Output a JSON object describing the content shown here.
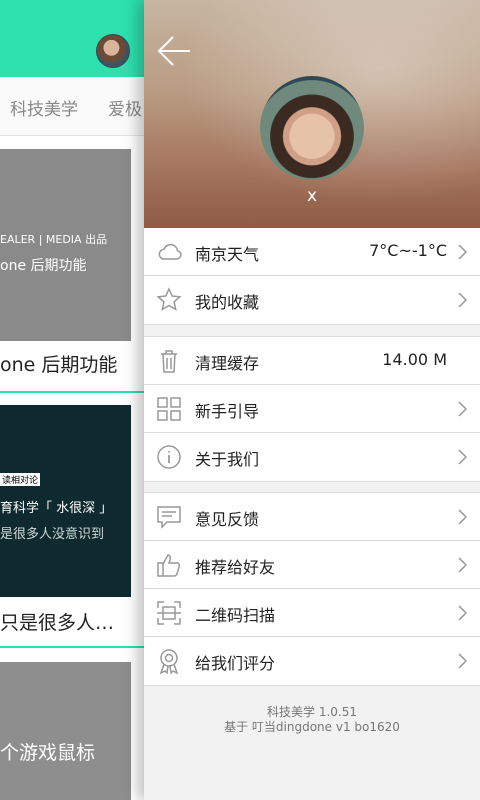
{
  "main": {
    "tabs": [
      "科技美学",
      "爱极"
    ],
    "cards": [
      {
        "thumb_lines": [
          "EALER | MEDIA 出品",
          "one 后期功能"
        ],
        "title": "one 后期功能"
      },
      {
        "thumb_lines": [
          "读相对论",
          "育科学「 水很深 」",
          "是很多人没意识到"
        ],
        "title": "只是很多人…"
      },
      {
        "thumb_lines": [
          "个游戏鼠标"
        ],
        "title": ""
      }
    ]
  },
  "drawer": {
    "username": "x",
    "groups": [
      [
        {
          "icon": "cloud-icon",
          "label": "南京天气",
          "value": "7°C~-1°C",
          "arrow": true
        },
        {
          "icon": "star-icon",
          "label": "我的收藏",
          "value": "",
          "arrow": true
        }
      ],
      [
        {
          "icon": "trash-icon",
          "label": "清理缓存",
          "value": "14.00 M",
          "arrow": false
        },
        {
          "icon": "grid-icon",
          "label": "新手引导",
          "value": "",
          "arrow": true
        },
        {
          "icon": "info-icon",
          "label": "关于我们",
          "value": "",
          "arrow": true
        }
      ],
      [
        {
          "icon": "feedback-icon",
          "label": "意见反馈",
          "value": "",
          "arrow": true
        },
        {
          "icon": "thumbs-up-icon",
          "label": "推荐给好友",
          "value": "",
          "arrow": true
        },
        {
          "icon": "qr-scan-icon",
          "label": "二维码扫描",
          "value": "",
          "arrow": true
        },
        {
          "icon": "award-icon",
          "label": "给我们评分",
          "value": "",
          "arrow": true
        }
      ]
    ],
    "footer": {
      "version": "科技美学 1.0.51",
      "powered_by": "基于 叮当dingdone v1 bo1620"
    }
  },
  "colors": {
    "accent": "#2de0ad",
    "icon_gray": "#999999"
  }
}
